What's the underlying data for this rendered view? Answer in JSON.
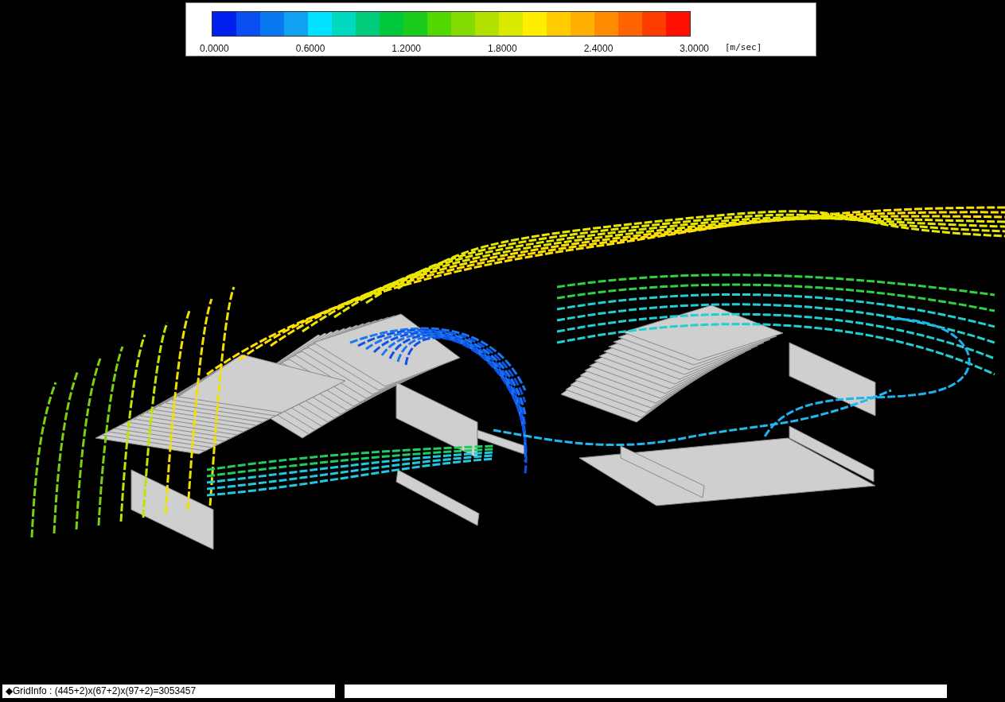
{
  "legend": {
    "swatches": [
      {
        "color": "#0020f0"
      },
      {
        "color": "#0a4ff2"
      },
      {
        "color": "#0a78f0"
      },
      {
        "color": "#10a2f0"
      },
      {
        "color": "#00e2ff"
      },
      {
        "color": "#00d8c0"
      },
      {
        "color": "#00cc7c"
      },
      {
        "color": "#00c83c"
      },
      {
        "color": "#1ccc1c"
      },
      {
        "color": "#50d800"
      },
      {
        "color": "#84dc00"
      },
      {
        "color": "#b4e200"
      },
      {
        "color": "#dcea00"
      },
      {
        "color": "#ffee00"
      },
      {
        "color": "#ffcc00"
      },
      {
        "color": "#ffb000"
      },
      {
        "color": "#ff8c00"
      },
      {
        "color": "#ff6400"
      },
      {
        "color": "#ff3c00"
      },
      {
        "color": "#ff1000"
      }
    ],
    "ticks": [
      "0.0000",
      "0.6000",
      "1.2000",
      "1.8000",
      "2.4000",
      "3.0000"
    ],
    "unit": "[m/sec]"
  },
  "status_bar": {
    "grid_info": "◆GridInfo : (445+2)x(67+2)x(97+2)=3053457"
  }
}
